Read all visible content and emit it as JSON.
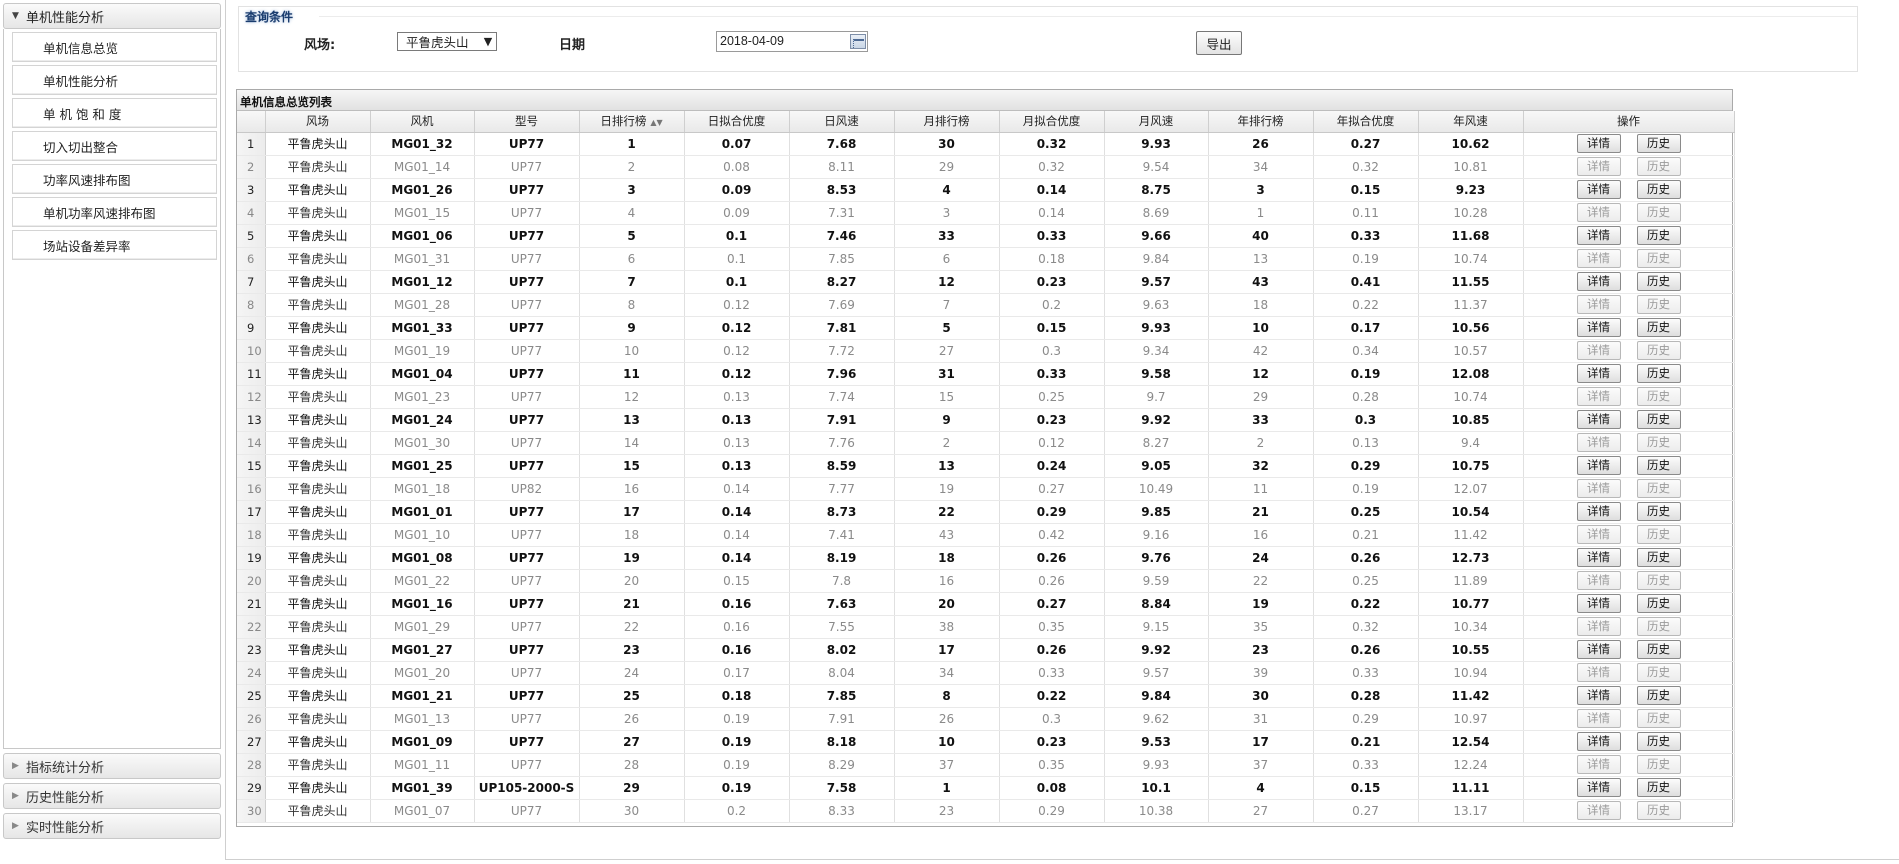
{
  "sidebar": {
    "main_section": {
      "label": "单机性能分析",
      "expanded": true
    },
    "items": [
      {
        "label": "单机信息总览"
      },
      {
        "label": "单机性能分析"
      },
      {
        "label": "单 机 饱 和 度"
      },
      {
        "label": "切入切出整合"
      },
      {
        "label": "功率风速排布图"
      },
      {
        "label": "单机功率风速排布图"
      },
      {
        "label": "场站设备差异率"
      }
    ],
    "collapsed_sections": [
      {
        "label": "指标统计分析"
      },
      {
        "label": "历史性能分析"
      },
      {
        "label": "实时性能分析"
      }
    ],
    "icons": {
      "expanded": "triangle-down-icon",
      "collapsed": "triangle-right-icon"
    }
  },
  "query": {
    "title": "查询条件",
    "farm_label": "风场:",
    "farm_selected": "平鲁虎头山",
    "date_label": "日期",
    "date_value": "2018-04-09",
    "export_label": "导出"
  },
  "table": {
    "title": "单机信息总览列表",
    "columns": [
      "",
      "风场",
      "风机",
      "型号",
      "日排行榜",
      "日拟合优度",
      "日风速",
      "月排行榜",
      "月拟合优度",
      "月风速",
      "年排行榜",
      "年拟合优度",
      "年风速",
      "操作"
    ],
    "action_labels": {
      "detail": "详情",
      "history": "历史"
    },
    "rows": [
      [
        "1",
        "平鲁虎头山",
        "MG01_32",
        "UP77",
        "1",
        "0.07",
        "7.68",
        "30",
        "0.32",
        "9.93",
        "26",
        "0.27",
        "10.62"
      ],
      [
        "2",
        "平鲁虎头山",
        "MG01_14",
        "UP77",
        "2",
        "0.08",
        "8.11",
        "29",
        "0.32",
        "9.54",
        "34",
        "0.32",
        "10.81"
      ],
      [
        "3",
        "平鲁虎头山",
        "MG01_26",
        "UP77",
        "3",
        "0.09",
        "8.53",
        "4",
        "0.14",
        "8.75",
        "3",
        "0.15",
        "9.23"
      ],
      [
        "4",
        "平鲁虎头山",
        "MG01_15",
        "UP77",
        "4",
        "0.09",
        "7.31",
        "3",
        "0.14",
        "8.69",
        "1",
        "0.11",
        "10.28"
      ],
      [
        "5",
        "平鲁虎头山",
        "MG01_06",
        "UP77",
        "5",
        "0.1",
        "7.46",
        "33",
        "0.33",
        "9.66",
        "40",
        "0.33",
        "11.68"
      ],
      [
        "6",
        "平鲁虎头山",
        "MG01_31",
        "UP77",
        "6",
        "0.1",
        "7.85",
        "6",
        "0.18",
        "9.84",
        "13",
        "0.19",
        "10.74"
      ],
      [
        "7",
        "平鲁虎头山",
        "MG01_12",
        "UP77",
        "7",
        "0.1",
        "8.27",
        "12",
        "0.23",
        "9.57",
        "43",
        "0.41",
        "11.55"
      ],
      [
        "8",
        "平鲁虎头山",
        "MG01_28",
        "UP77",
        "8",
        "0.12",
        "7.69",
        "7",
        "0.2",
        "9.63",
        "18",
        "0.22",
        "11.37"
      ],
      [
        "9",
        "平鲁虎头山",
        "MG01_33",
        "UP77",
        "9",
        "0.12",
        "7.81",
        "5",
        "0.15",
        "9.93",
        "10",
        "0.17",
        "10.56"
      ],
      [
        "10",
        "平鲁虎头山",
        "MG01_19",
        "UP77",
        "10",
        "0.12",
        "7.72",
        "27",
        "0.3",
        "9.34",
        "42",
        "0.34",
        "10.57"
      ],
      [
        "11",
        "平鲁虎头山",
        "MG01_04",
        "UP77",
        "11",
        "0.12",
        "7.96",
        "31",
        "0.33",
        "9.58",
        "12",
        "0.19",
        "12.08"
      ],
      [
        "12",
        "平鲁虎头山",
        "MG01_23",
        "UP77",
        "12",
        "0.13",
        "7.74",
        "15",
        "0.25",
        "9.7",
        "29",
        "0.28",
        "10.74"
      ],
      [
        "13",
        "平鲁虎头山",
        "MG01_24",
        "UP77",
        "13",
        "0.13",
        "7.91",
        "9",
        "0.23",
        "9.92",
        "33",
        "0.3",
        "10.85"
      ],
      [
        "14",
        "平鲁虎头山",
        "MG01_30",
        "UP77",
        "14",
        "0.13",
        "7.76",
        "2",
        "0.12",
        "8.27",
        "2",
        "0.13",
        "9.4"
      ],
      [
        "15",
        "平鲁虎头山",
        "MG01_25",
        "UP77",
        "15",
        "0.13",
        "8.59",
        "13",
        "0.24",
        "9.05",
        "32",
        "0.29",
        "10.75"
      ],
      [
        "16",
        "平鲁虎头山",
        "MG01_18",
        "UP82",
        "16",
        "0.14",
        "7.77",
        "19",
        "0.27",
        "10.49",
        "11",
        "0.19",
        "12.07"
      ],
      [
        "17",
        "平鲁虎头山",
        "MG01_01",
        "UP77",
        "17",
        "0.14",
        "8.73",
        "22",
        "0.29",
        "9.85",
        "21",
        "0.25",
        "10.54"
      ],
      [
        "18",
        "平鲁虎头山",
        "MG01_10",
        "UP77",
        "18",
        "0.14",
        "7.41",
        "43",
        "0.42",
        "9.16",
        "16",
        "0.21",
        "11.42"
      ],
      [
        "19",
        "平鲁虎头山",
        "MG01_08",
        "UP77",
        "19",
        "0.14",
        "8.19",
        "18",
        "0.26",
        "9.76",
        "24",
        "0.26",
        "12.73"
      ],
      [
        "20",
        "平鲁虎头山",
        "MG01_22",
        "UP77",
        "20",
        "0.15",
        "7.8",
        "16",
        "0.26",
        "9.59",
        "22",
        "0.25",
        "11.89"
      ],
      [
        "21",
        "平鲁虎头山",
        "MG01_16",
        "UP77",
        "21",
        "0.16",
        "7.63",
        "20",
        "0.27",
        "8.84",
        "19",
        "0.22",
        "10.77"
      ],
      [
        "22",
        "平鲁虎头山",
        "MG01_29",
        "UP77",
        "22",
        "0.16",
        "7.55",
        "38",
        "0.35",
        "9.15",
        "35",
        "0.32",
        "10.34"
      ],
      [
        "23",
        "平鲁虎头山",
        "MG01_27",
        "UP77",
        "23",
        "0.16",
        "8.02",
        "17",
        "0.26",
        "9.92",
        "23",
        "0.26",
        "10.55"
      ],
      [
        "24",
        "平鲁虎头山",
        "MG01_20",
        "UP77",
        "24",
        "0.17",
        "8.04",
        "34",
        "0.33",
        "9.57",
        "39",
        "0.33",
        "10.94"
      ],
      [
        "25",
        "平鲁虎头山",
        "MG01_21",
        "UP77",
        "25",
        "0.18",
        "7.85",
        "8",
        "0.22",
        "9.84",
        "30",
        "0.28",
        "11.42"
      ],
      [
        "26",
        "平鲁虎头山",
        "MG01_13",
        "UP77",
        "26",
        "0.19",
        "7.91",
        "26",
        "0.3",
        "9.62",
        "31",
        "0.29",
        "10.97"
      ],
      [
        "27",
        "平鲁虎头山",
        "MG01_09",
        "UP77",
        "27",
        "0.19",
        "8.18",
        "10",
        "0.23",
        "9.53",
        "17",
        "0.21",
        "12.54"
      ],
      [
        "28",
        "平鲁虎头山",
        "MG01_11",
        "UP77",
        "28",
        "0.19",
        "8.29",
        "37",
        "0.35",
        "9.93",
        "37",
        "0.33",
        "12.24"
      ],
      [
        "29",
        "平鲁虎头山",
        "MG01_39",
        "UP105-2000-S",
        "29",
        "0.19",
        "7.58",
        "1",
        "0.08",
        "10.1",
        "4",
        "0.15",
        "11.11"
      ],
      [
        "30",
        "平鲁虎头山",
        "MG01_07",
        "UP77",
        "30",
        "0.2",
        "8.33",
        "23",
        "0.29",
        "10.38",
        "27",
        "0.27",
        "13.17"
      ]
    ]
  }
}
